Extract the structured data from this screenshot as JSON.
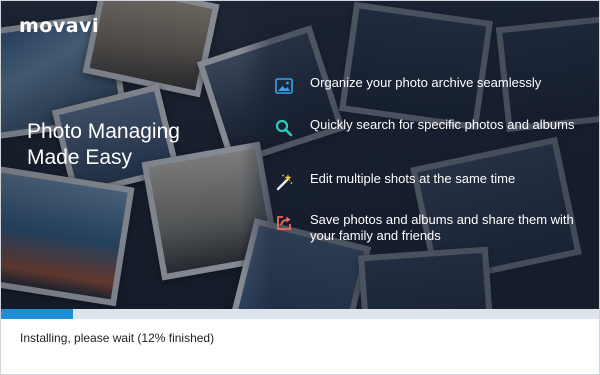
{
  "brand": {
    "logo_text": "movavi"
  },
  "hero": {
    "headline_line1": "Photo Managing",
    "headline_line2": "Made Easy"
  },
  "features": [
    {
      "icon": "photo-archive-icon",
      "text": "Organize your photo archive seamlessly",
      "color": "#35a7e8"
    },
    {
      "icon": "search-icon",
      "text": "Quickly search for specific photos and albums",
      "color": "#35c7b8"
    },
    {
      "icon": "magic-wand-icon",
      "text": "Edit multiple shots at the same time",
      "color": "#f2c94c"
    },
    {
      "icon": "share-icon",
      "text": "Save photos and albums and share them with your family and friends",
      "color": "#ef6b5b"
    }
  ],
  "progress": {
    "fraction": 0.12,
    "color": "#1e8fd6"
  },
  "status": {
    "text": "Installing, please wait (12% finished)"
  }
}
